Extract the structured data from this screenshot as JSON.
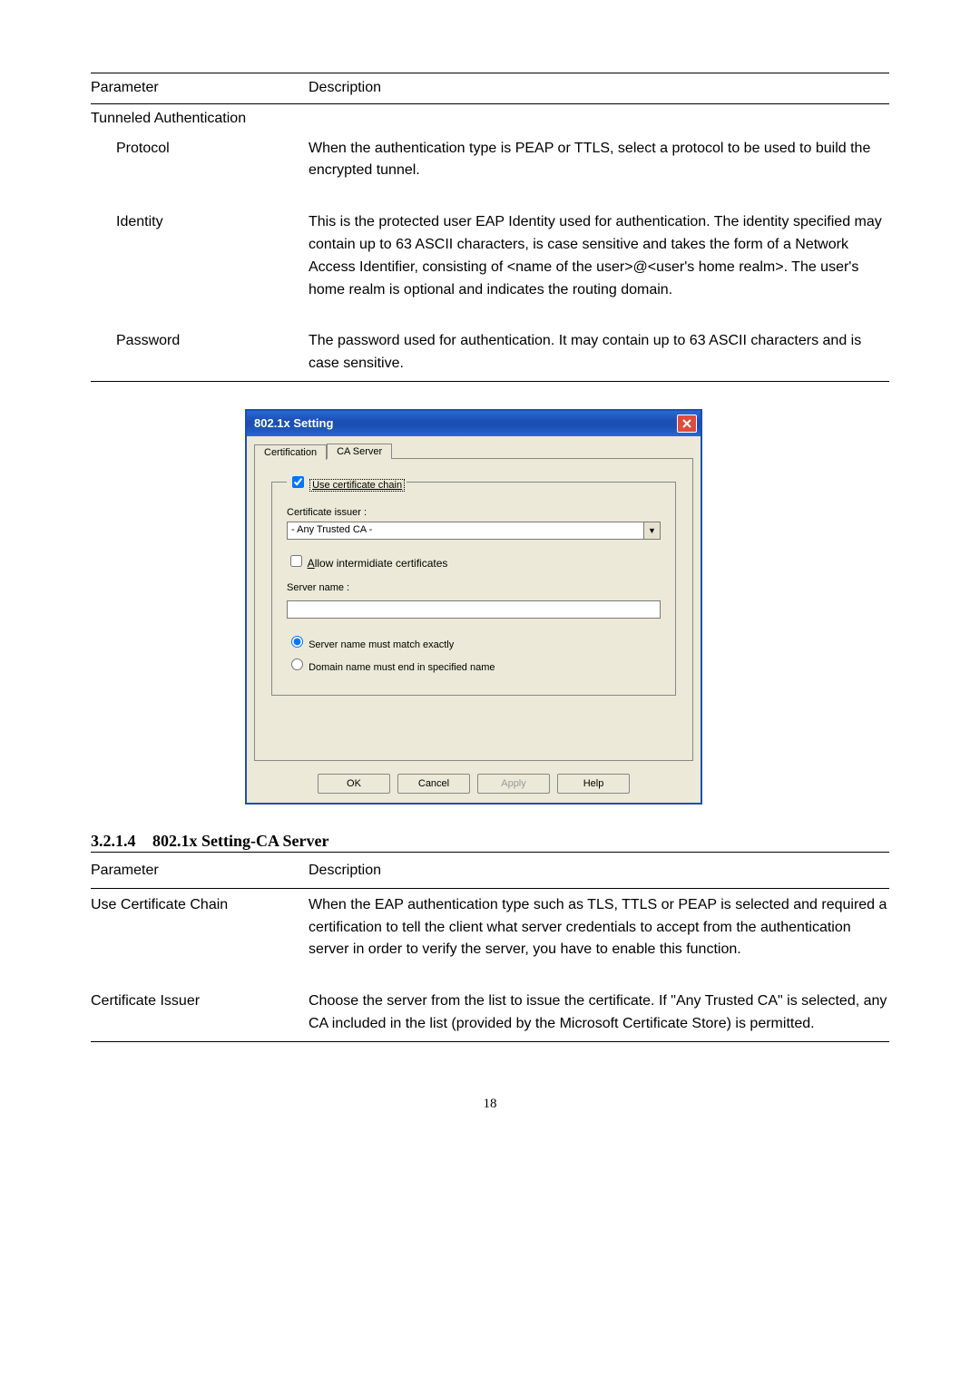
{
  "table1": {
    "headers": {
      "param": "Parameter",
      "desc": "Description"
    },
    "section_label": "Tunneled Authentication",
    "rows": [
      {
        "param": "Protocol",
        "desc": "When the authentication type is PEAP or TTLS, select a protocol to be used to build the encrypted tunnel."
      },
      {
        "param": "Identity",
        "desc": "This is the protected user EAP Identity used for authentication. The identity specified may contain up to 63 ASCII characters, is case sensitive and takes the form of a Network Access Identifier, consisting of <name of the user>@<user's home realm>. The user's home realm is optional and indicates the routing domain."
      },
      {
        "param": "Password",
        "desc": "The password used for authentication. It may contain up to 63 ASCII characters and is case sensitive."
      }
    ]
  },
  "dialog": {
    "title": "802.1x Setting",
    "tabs": {
      "certification": "Certification",
      "ca_server": "CA Server"
    },
    "use_cert_chain": "Use certificate chain",
    "cert_issuer_label": "Certificate issuer :",
    "cert_issuer_value": "- Any Trusted CA -",
    "allow_intermediate": "Allow intermidiate certificates",
    "server_name_label": "Server name :",
    "server_name_value": "",
    "radio_exact": "Server name must match exactly",
    "radio_domain": "Domain name must end in specified name",
    "buttons": {
      "ok": "OK",
      "cancel": "Cancel",
      "apply": "Apply",
      "help": "Help"
    }
  },
  "section_heading": {
    "num": "3.2.1.4",
    "title": "802.1x Setting-CA Server"
  },
  "table2": {
    "headers": {
      "param": "Parameter",
      "desc": "Description"
    },
    "rows": [
      {
        "param": "Use Certificate Chain",
        "desc": "When the EAP authentication type such as TLS, TTLS or PEAP is selected and required a certification to tell the client what server credentials to accept from the authentication server in order to verify the server, you have to enable this function."
      },
      {
        "param": "Certificate Issuer",
        "desc": "Choose the server from the list to issue the certificate. If \"Any Trusted CA\" is selected, any CA included in the list (provided by the Microsoft Certificate Store) is permitted."
      }
    ]
  },
  "page_number": "18"
}
